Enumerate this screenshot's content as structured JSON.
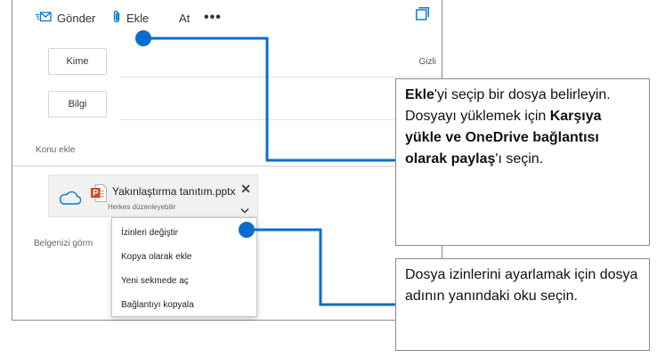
{
  "toolbar": {
    "send_label": "Gönder",
    "attach_label": "Ekle",
    "at_label": "At",
    "more_label": "•••"
  },
  "fields": {
    "to_label": "Kime",
    "cc_label": "Bilgi",
    "bcc_label": "Gizli",
    "subject_placeholder": "Konu ekle",
    "body_placeholder": "Belgenizi görm"
  },
  "attachment": {
    "file_name": "Yakınlaştırma tanıtım.pptx",
    "permission": "Herkes düzenleyebilir",
    "close_glyph": "✕"
  },
  "menu": {
    "items": [
      "İzinleri değiştir",
      "Kopya olarak ekle",
      "Yeni sekmede aç",
      "Bağlantıyı kopyala"
    ]
  },
  "callouts": {
    "attach": {
      "p1_bold": "Ekle",
      "p1": "'yi seçip bir dosya belirleyin. Dosyayı yüklemek için ",
      "p2_bold": "Karşıya yükle ve OneDrive bağlantısı olarak paylaş",
      "p3": "'ı seçin."
    },
    "permissions": {
      "text": "Dosya izinlerini ayarlamak için dosya adının yanındaki oku seçin."
    }
  },
  "icons": {
    "send": "send-icon",
    "attach": "paperclip-icon",
    "popout": "popout-icon",
    "cloud": "onedrive-cloud-icon",
    "powerpoint": "powerpoint-file-icon",
    "dropdown": "chevron-down-icon"
  },
  "colors": {
    "accent": "#0078d4",
    "powerpoint": "#d24726",
    "connector": "#0a6ccf"
  }
}
